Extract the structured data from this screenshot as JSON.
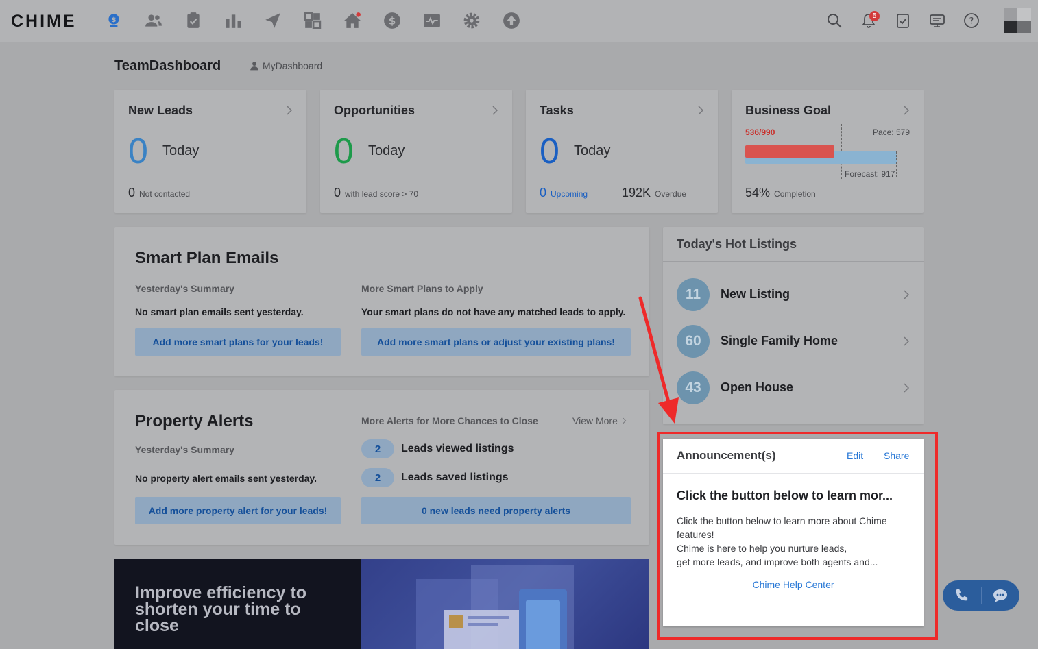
{
  "app": {
    "logo": "CHIME"
  },
  "nav": {
    "icons": [
      "dashboard-icon",
      "people-icon",
      "clipboard-icon",
      "bar-chart-icon",
      "send-icon",
      "apps-icon",
      "home-icon",
      "dollar-icon",
      "activity-icon",
      "gear-icon",
      "upload-icon"
    ],
    "notifications_count": "5"
  },
  "header": {
    "title": "TeamDashboard",
    "my_dashboard": "MyDashboard"
  },
  "cards": {
    "new_leads": {
      "title": "New Leads",
      "value": "0",
      "period": "Today",
      "sub_value": "0",
      "sub_label": "Not contacted",
      "color": "#3a82c4"
    },
    "opportunities": {
      "title": "Opportunities",
      "value": "0",
      "period": "Today",
      "sub_value": "0",
      "sub_label": "with lead score > 70",
      "color": "#1d9a4a"
    },
    "tasks": {
      "title": "Tasks",
      "value": "0",
      "period": "Today",
      "upcoming_value": "0",
      "upcoming_label": "Upcoming",
      "overdue_value": "192K",
      "overdue_label": "Overdue",
      "color": "#1a5fc2"
    },
    "business_goal": {
      "title": "Business Goal",
      "progress_text": "536/990",
      "pace": "Pace: 579",
      "forecast": "Forecast: 917",
      "completion_value": "54%",
      "completion_label": "Completion",
      "progress_fraction": 0.54,
      "forecast_fraction": 0.926
    }
  },
  "smart_plan": {
    "title": "Smart Plan Emails",
    "summary_label": "Yesterday's Summary",
    "summary_text": "No smart plan emails sent yesterday.",
    "summary_button": "Add more smart plans for your leads!",
    "more_label": "More Smart Plans to Apply",
    "more_text": "Your smart plans do not have any matched leads to apply.",
    "more_button": "Add more smart plans or adjust your existing plans!"
  },
  "property_alerts": {
    "title": "Property Alerts",
    "summary_label": "Yesterday's Summary",
    "summary_text": "No property alert emails sent yesterday.",
    "summary_button": "Add more property alert for your leads!",
    "more_label": "More Alerts for More Chances to Close",
    "view_more": "View More",
    "stats": [
      {
        "count": "2",
        "label": "Leads viewed listings"
      },
      {
        "count": "2",
        "label": "Leads saved listings"
      }
    ],
    "new_leads_button": "0 new leads need property alerts"
  },
  "hot_listings": {
    "title": "Today's Hot Listings",
    "items": [
      {
        "count": "11",
        "label": "New Listing"
      },
      {
        "count": "60",
        "label": "Single Family Home"
      },
      {
        "count": "43",
        "label": "Open House"
      }
    ]
  },
  "announcement": {
    "title": "Announcement(s)",
    "edit": "Edit",
    "share": "Share",
    "heading": "Click the button below to learn mor...",
    "body_1": "Click the button below to learn more about Chime features!",
    "body_2": "Chime is here to help you nurture leads,",
    "body_3": "get more leads, and improve both agents and...",
    "help_link": "Chime Help Center"
  },
  "banner": {
    "text": "Improve efficiency to shorten your time to close"
  },
  "colors": {
    "accent": "#2878d6",
    "annotation_red": "#ee2a2a",
    "goal_red": "#d9534f",
    "goal_blue": "#8ab3d1"
  }
}
